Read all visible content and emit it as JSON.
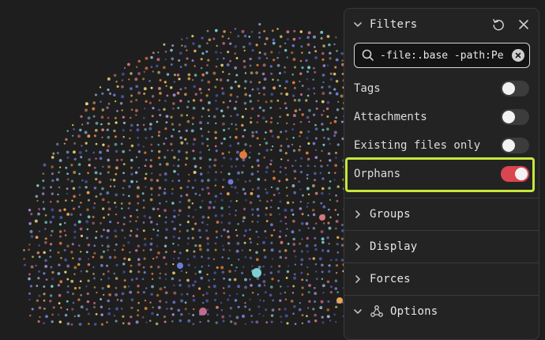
{
  "graph": {
    "background": "#1e1e1e",
    "node_palette": [
      "#e8a657",
      "#e07b3f",
      "#6c7bd6",
      "#4a55a8",
      "#c76a8a",
      "#8fb0d8",
      "#e9d27a",
      "#7ccfd1",
      "#d47a7a",
      "#a38cd6"
    ]
  },
  "filters": {
    "title": "Filters",
    "reset_icon": "reset-icon",
    "close_icon": "close-icon",
    "search": {
      "value": "-file:.base -path:Pe",
      "icon": "search-icon",
      "clear_icon": "clear-icon"
    },
    "toggles": [
      {
        "label": "Tags",
        "on": false
      },
      {
        "label": "Attachments",
        "on": false
      },
      {
        "label": "Existing files only",
        "on": false
      },
      {
        "label": "Orphans",
        "on": true
      }
    ],
    "accent_on": "#d94650",
    "highlight_color": "#c6e83a"
  },
  "sections": [
    {
      "label": "Groups",
      "icon": "chevron-right-icon"
    },
    {
      "label": "Display",
      "icon": "chevron-right-icon"
    },
    {
      "label": "Forces",
      "icon": "chevron-right-icon"
    }
  ],
  "options": {
    "label": "Options",
    "icon": "graph-options-icon"
  }
}
